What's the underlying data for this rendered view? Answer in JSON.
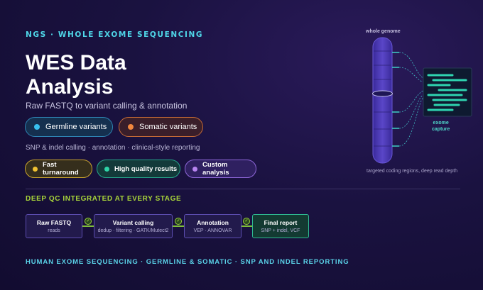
{
  "eyebrow": "NGS · WHOLE EXOME SEQUENCING",
  "title": "WES Data Analysis",
  "subtitle": "Raw FASTQ to variant calling & annotation",
  "variant_pills": [
    {
      "label": "Germline variants",
      "color": "#38c0ee"
    },
    {
      "label": "Somatic variants",
      "color": "#f0873e"
    }
  ],
  "caption": "SNP & indel calling · annotation · clinical-style reporting",
  "feature_pills": [
    {
      "label": "Fast turnaround",
      "color": "#f1c232"
    },
    {
      "label": "High quality results",
      "color": "#2fd4a8"
    },
    {
      "label": "Custom analysis",
      "color": "#b884f0"
    }
  ],
  "qc_heading": "DEEP QC INTEGRATED AT EVERY STAGE",
  "pipeline": [
    {
      "title": "Raw FASTQ",
      "sub": "reads"
    },
    {
      "title": "Variant calling",
      "sub": "dedup · filtering · GATK/Mutect2"
    },
    {
      "title": "Annotation",
      "sub": "VEP · ANNOVAR"
    },
    {
      "title": "Final report",
      "sub": "SNP + indel, VCF"
    }
  ],
  "footer": "HUMAN EXOME SEQUENCING · GERMLINE & SOMATIC · SNP AND INDEL REPORTING",
  "diagram": {
    "genome_label": "whole genome",
    "exome_label_1": "exome",
    "exome_label_2": "capture",
    "caption": "targeted coding regions, deep read depth"
  }
}
